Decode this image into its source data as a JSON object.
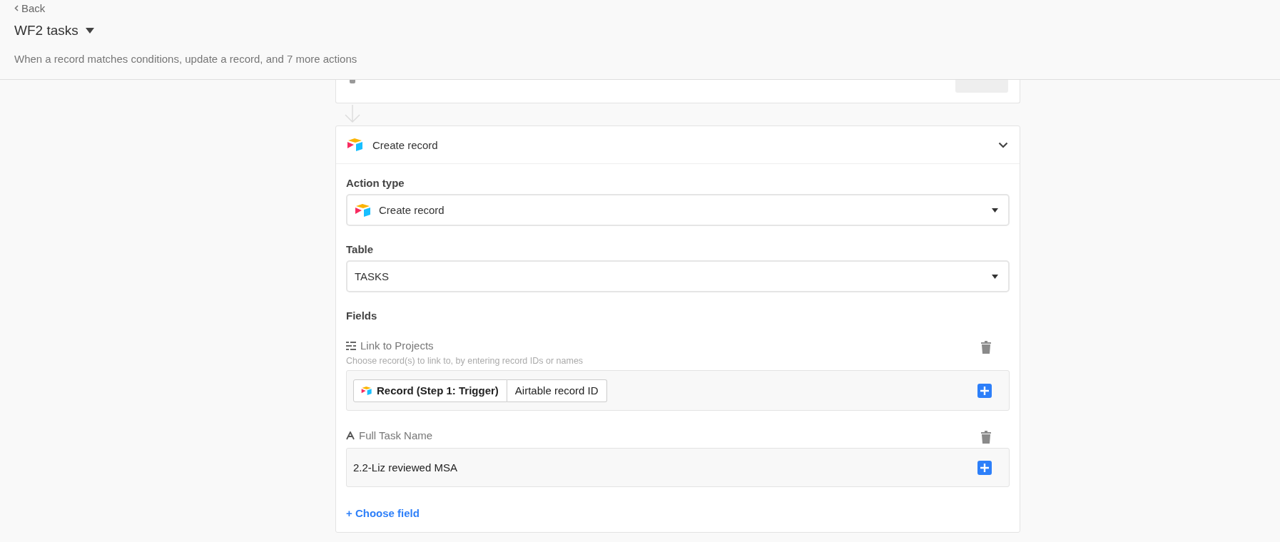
{
  "header": {
    "back_link": "Back",
    "title": "WF2 tasks",
    "subtitle": "When a record matches conditions, update a record, and 7 more actions"
  },
  "step": {
    "title": "Create record",
    "expanded": true,
    "action_type": {
      "label": "Action type",
      "value": "Create record"
    },
    "table": {
      "label": "Table",
      "value": "TASKS"
    },
    "fields_label": "Fields",
    "fields": [
      {
        "kind": "link",
        "name": "Link to Projects",
        "hint": "Choose record(s) to link to, by entering record IDs or names",
        "tokens": [
          "Record (Step 1: Trigger)",
          "Airtable record ID"
        ]
      },
      {
        "kind": "text",
        "name": "Full Task Name",
        "value": "2.2-Liz reviewed MSA"
      }
    ],
    "choose_field": "+ Choose field"
  }
}
